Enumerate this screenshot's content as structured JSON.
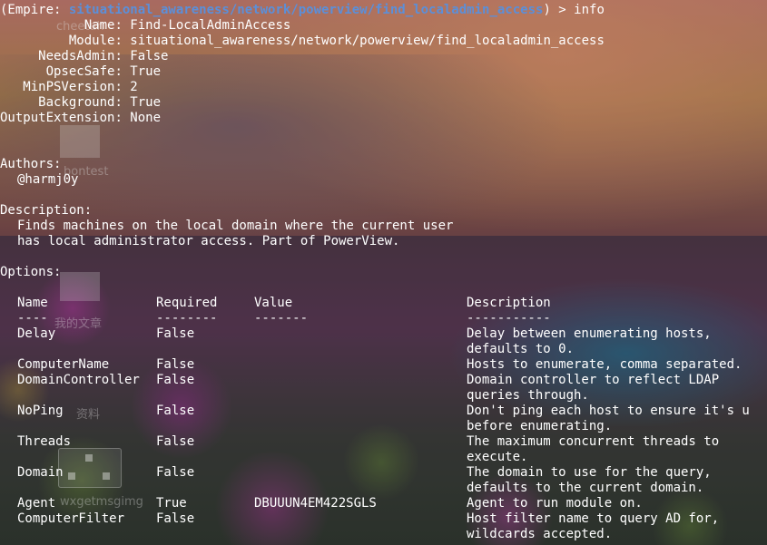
{
  "prompt": {
    "prefix": "(Empire: ",
    "path": "situational_awareness/network/powerview/find_localadmin_access",
    "suffix": ") > ",
    "command": "info"
  },
  "info": [
    {
      "key": "Name",
      "value": "Find-LocalAdminAccess"
    },
    {
      "key": "Module",
      "value": "situational_awareness/network/powerview/find_localadmin_access"
    },
    {
      "key": "NeedsAdmin",
      "value": "False"
    },
    {
      "key": "OpsecSafe",
      "value": "True"
    },
    {
      "key": "MinPSVersion",
      "value": "2"
    },
    {
      "key": "Background",
      "value": "True"
    },
    {
      "key": "OutputExtension",
      "value": "None"
    }
  ],
  "authors_header": "Authors:",
  "authors": [
    "@harmj0y"
  ],
  "description_header": "Description:",
  "description_lines": [
    "Finds machines on the local domain where the current user",
    "has local administrator access. Part of PowerView."
  ],
  "options_header": "Options:",
  "columns": {
    "name": "Name",
    "required": "Required",
    "value": "Value",
    "description": "Description"
  },
  "separators": {
    "name": "----",
    "required": "--------",
    "value": "-------",
    "description": "-----------"
  },
  "options": [
    {
      "name": "Delay",
      "required": "False",
      "value": "",
      "desc": [
        "Delay between enumerating hosts,",
        "defaults to 0."
      ]
    },
    {
      "name": "ComputerName",
      "required": "False",
      "value": "",
      "desc": [
        "Hosts to enumerate, comma separated."
      ]
    },
    {
      "name": "DomainController",
      "required": "False",
      "value": "",
      "desc": [
        "Domain controller to reflect LDAP",
        "queries through."
      ]
    },
    {
      "name": "NoPing",
      "required": "False",
      "value": "",
      "desc": [
        "Don't ping each host to ensure it's u",
        "before enumerating."
      ]
    },
    {
      "name": "Threads",
      "required": "False",
      "value": "",
      "desc": [
        "The maximum concurrent threads to",
        "execute."
      ]
    },
    {
      "name": "Domain",
      "required": "False",
      "value": "",
      "desc": [
        "The domain to use for the query,",
        "defaults to the current domain."
      ]
    },
    {
      "name": "Agent",
      "required": "True",
      "value": "DBUUUN4EM422SGLS",
      "desc": [
        "Agent to run module on."
      ]
    },
    {
      "name": "ComputerFilter",
      "required": "False",
      "value": "",
      "desc": [
        "Host filter name to query AD for,",
        "wildcards accepted."
      ]
    }
  ],
  "overlay": {
    "label_cheetah": "cheetah",
    "label_bontest": "bontest",
    "label_wenzhang": "我的文章",
    "label_ziliao": "资料",
    "label_wx": "wxgetmsgimg"
  },
  "colors": {
    "path": "#5b8fd9",
    "text": "#ffffff"
  }
}
